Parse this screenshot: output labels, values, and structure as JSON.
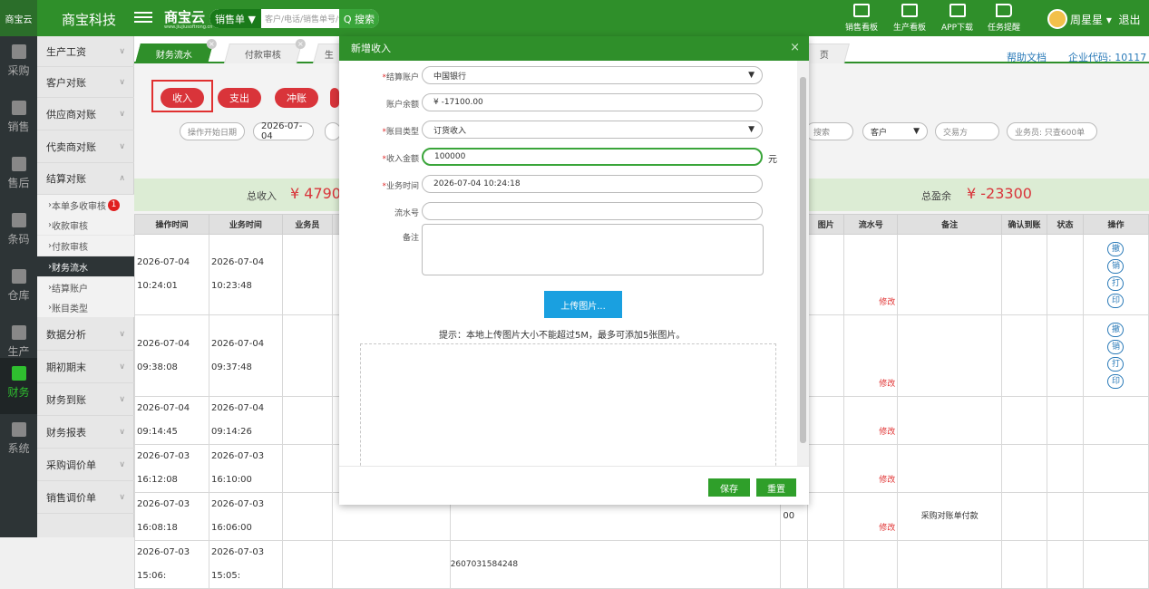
{
  "topbar": {
    "logo_text": "商宝云",
    "company": "商宝科技",
    "brand": "商宝云",
    "brand_sub": "www.jiujiusoftrong.cn",
    "search_scope": "销售单 ▼",
    "search_placeholder": "客户/电话/销售单号/订单号",
    "search_button": "Q 搜索",
    "icons": [
      {
        "label": "销售看板",
        "icon": "sales-board-icon"
      },
      {
        "label": "生产看板",
        "icon": "production-board-icon"
      },
      {
        "label": "APP下载",
        "icon": "qr-code-icon"
      },
      {
        "label": "任务提醒",
        "icon": "flag-icon"
      }
    ],
    "user": "周星星 ▾",
    "logout": "退出"
  },
  "leftnav": [
    {
      "label": "采购",
      "icon": "purchase-icon"
    },
    {
      "label": "销售",
      "icon": "sales-icon"
    },
    {
      "label": "售后",
      "icon": "aftersales-icon"
    },
    {
      "label": "条码",
      "icon": "barcode-icon"
    },
    {
      "label": "仓库",
      "icon": "warehouse-icon"
    },
    {
      "label": "生产",
      "icon": "production-icon"
    },
    {
      "label": "财务",
      "icon": "finance-icon",
      "active": true
    },
    {
      "label": "系统",
      "icon": "system-icon"
    }
  ],
  "sidebar": {
    "items": [
      "生产工资",
      "客户对账",
      "供应商对账",
      "代卖商对账",
      "结算对账",
      "数据分析",
      "期初期末",
      "财务到账",
      "财务报表",
      "采购调价单",
      "销售调价单"
    ],
    "sub_items": [
      "本单多收审核",
      "收款审核",
      "付款审核",
      "财务流水",
      "结算账户",
      "账目类型"
    ],
    "badge": "1"
  },
  "tabs": [
    {
      "label": "财务流水",
      "active": true
    },
    {
      "label": "付款审核"
    },
    {
      "label": "生"
    },
    {
      "label": "页"
    }
  ],
  "help": {
    "doc": "帮助文档",
    "company_code": "企业代码: 10117"
  },
  "actions": {
    "income": "收入",
    "expense": "支出",
    "offset": "冲账"
  },
  "filters": {
    "start": "操作开始日期",
    "date": "2026-07-04",
    "search": "搜索",
    "customer": "客户",
    "trader": "交易方",
    "salesman": "业务员: 只查600单"
  },
  "summary": {
    "income_label": "总收入",
    "income_value": "¥ 4790",
    "profit_label": "总盈余",
    "profit_value": "¥ -23300"
  },
  "table": {
    "headers_left": [
      "操作时间",
      "业务时间",
      "业务员"
    ],
    "headers_right": [
      "额",
      "图片",
      "流水号",
      "备注",
      "确认到账",
      "状态",
      "操作"
    ],
    "rows": [
      {
        "op": "2026-07-04 10:24:01",
        "biz": "2026-07-04 10:23:48",
        "amt": "00",
        "fix": "修改",
        "note": ""
      },
      {
        "op": "2026-07-04 09:38:08",
        "biz": "2026-07-04 09:37:48",
        "amt": "00",
        "fix": "修改",
        "note": ""
      },
      {
        "op": "2026-07-04 09:14:45",
        "biz": "2026-07-04 09:14:26",
        "amt": "00",
        "fix": "修改",
        "note": ""
      },
      {
        "op": "2026-07-03 16:12:08",
        "biz": "2026-07-03 16:10:00",
        "amt": "00",
        "fix": "修改",
        "note": ""
      },
      {
        "op": "2026-07-03 16:08:18",
        "biz": "2026-07-03 16:06:00",
        "amt": "00",
        "fix": "修改",
        "note": "采购对账单付款"
      },
      {
        "op": "2026-07-03 15:06:",
        "biz": "2026-07-03 15:05:",
        "amt": "",
        "fix": "",
        "note": "",
        "serial": "2607031584248"
      }
    ],
    "op_buttons": [
      "撤",
      "销",
      "打",
      "印"
    ]
  },
  "modal": {
    "title": "新增收入",
    "close": "×",
    "fields": {
      "account_label": "结算账户",
      "account_value": "中国银行",
      "balance_label": "账户余额",
      "balance_value": "¥ -17100.00",
      "type_label": "账目类型",
      "type_value": "订货收入",
      "amount_label": "收入金额",
      "amount_value": "100000",
      "amount_unit": "元",
      "time_label": "业务时间",
      "time_value": "2026-07-04 10:24:18",
      "serial_label": "流水号",
      "serial_value": "",
      "note_label": "备注"
    },
    "upload_button": "上传图片...",
    "tip": "提示：本地上传图片大小不能超过5M，最多可添加5张图片。",
    "save": "保存",
    "reset": "重置"
  }
}
